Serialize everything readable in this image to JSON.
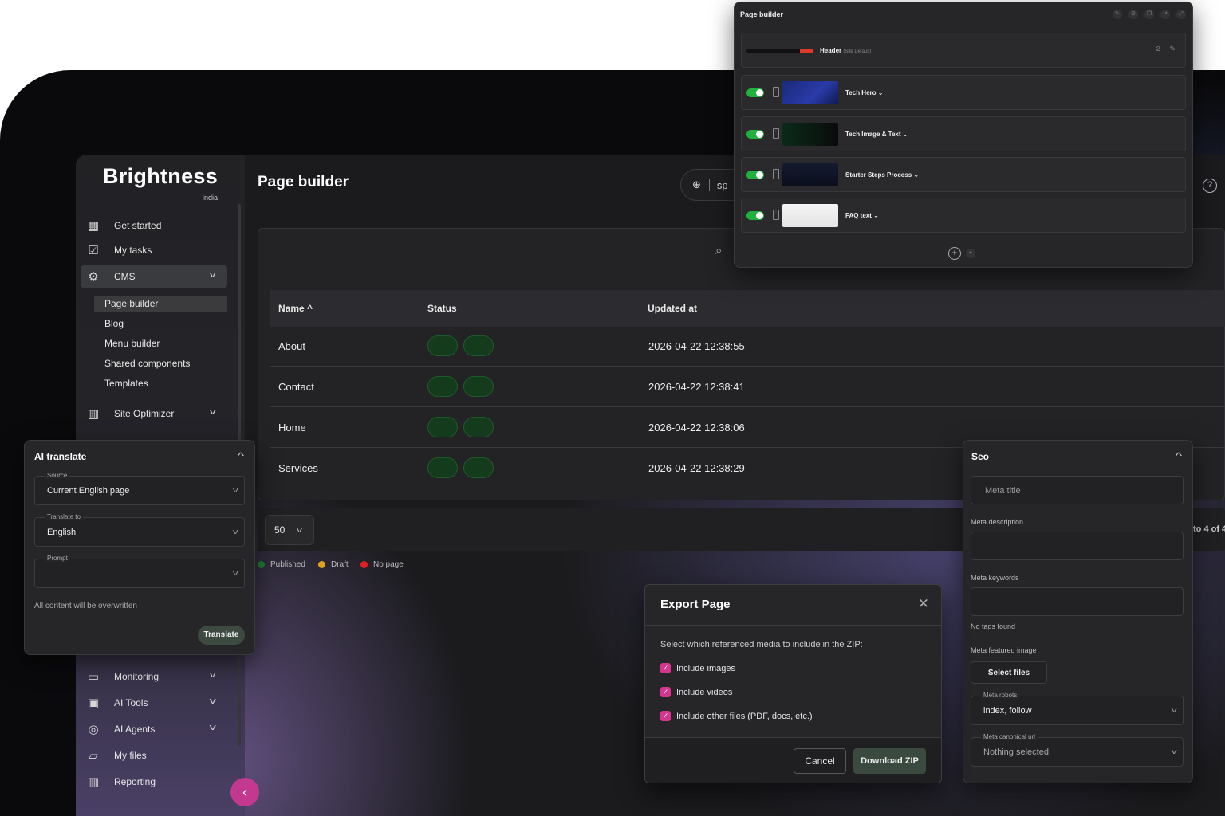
{
  "brand": {
    "name": "Brightness",
    "sub": "India"
  },
  "sidebar": {
    "items": [
      {
        "label": "Get started",
        "icon": "grid-plus-icon"
      },
      {
        "label": "My tasks",
        "icon": "clipboard-check-icon"
      },
      {
        "label": "CMS",
        "icon": "browser-gear-icon"
      },
      {
        "label": "Site Optimizer",
        "icon": "bar-chart-icon"
      },
      {
        "label": "Monitoring",
        "icon": "monitor-chart-icon"
      },
      {
        "label": "AI Tools",
        "icon": "ai-chip-icon"
      },
      {
        "label": "AI Agents",
        "icon": "ai-agent-icon"
      },
      {
        "label": "My files",
        "icon": "folder-image-icon"
      },
      {
        "label": "Reporting",
        "icon": "report-chart-icon"
      }
    ],
    "cms_sub": [
      "Page builder",
      "Blog",
      "Menu builder",
      "Shared components",
      "Templates"
    ]
  },
  "main": {
    "title": "Page builder",
    "lang_code": "sp",
    "table": {
      "headers": {
        "name": "Name",
        "status": "Status",
        "updated": "Updated at"
      },
      "rows": [
        {
          "name": "About",
          "updated": "2026-04-22 12:38:55"
        },
        {
          "name": "Contact",
          "updated": "2026-04-22 12:38:41"
        },
        {
          "name": "Home",
          "updated": "2026-04-22 12:38:06"
        },
        {
          "name": "Services",
          "updated": "2026-04-22 12:38:29"
        }
      ]
    },
    "per_page": "50",
    "range": "to 4 of 4",
    "legend": [
      {
        "label": "Published",
        "color": "#1f7a2e"
      },
      {
        "label": "Draft",
        "color": "#e0a020"
      },
      {
        "label": "No page",
        "color": "#e02020"
      }
    ]
  },
  "page_builder": {
    "title": "Page builder",
    "header_row": {
      "label": "Header",
      "note": "(Site Default)"
    },
    "sections": [
      "Tech Hero",
      "Tech Image & Text",
      "Starter Steps Process",
      "FAQ text"
    ]
  },
  "ai_translate": {
    "title": "AI translate",
    "source_label": "Source",
    "source_value": "Current English page",
    "translate_label": "Translate to",
    "translate_value": "English",
    "prompt_label": "Prompt",
    "note": "All content will be overwritten",
    "button": "Translate"
  },
  "seo": {
    "title": "Seo",
    "meta_title_ph": "Meta title",
    "meta_description": "Meta description",
    "meta_keywords": "Meta keywords",
    "no_tags": "No tags found",
    "featured_image": "Meta featured image",
    "select_files": "Select files",
    "robots_label": "Meta robots",
    "robots_value": "index, follow",
    "canonical_label": "Meta canonical url",
    "canonical_value": "Nothing selected"
  },
  "export": {
    "title": "Export Page",
    "description": "Select which referenced media to include in the ZIP:",
    "options": [
      "Include images",
      "Include videos",
      "Include other files (PDF, docs, etc.)"
    ],
    "cancel": "Cancel",
    "download": "Download ZIP"
  }
}
